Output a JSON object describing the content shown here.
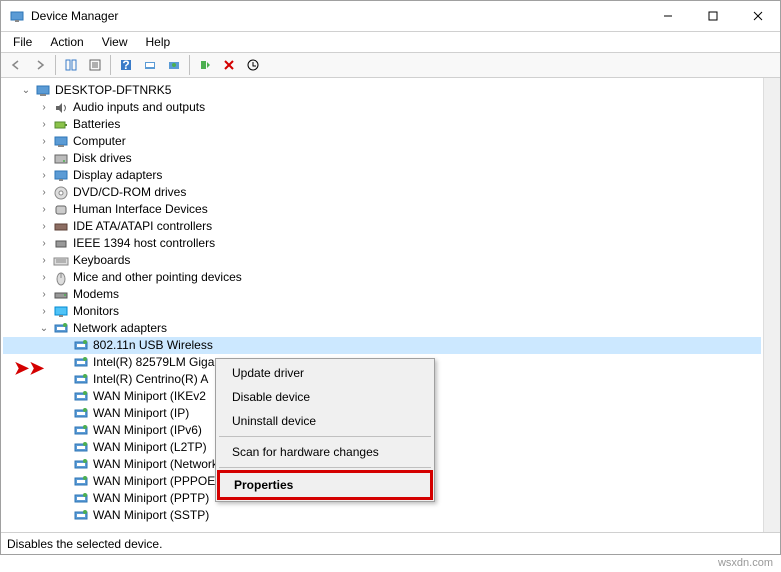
{
  "window": {
    "title": "Device Manager"
  },
  "menu": {
    "file": "File",
    "action": "Action",
    "view": "View",
    "help": "Help"
  },
  "root": "DESKTOP-DFTNRK5",
  "cats": [
    "Audio inputs and outputs",
    "Batteries",
    "Computer",
    "Disk drives",
    "Display adapters",
    "DVD/CD-ROM drives",
    "Human Interface Devices",
    "IDE ATA/ATAPI controllers",
    "IEEE 1394 host controllers",
    "Keyboards",
    "Mice and other pointing devices",
    "Modems",
    "Monitors"
  ],
  "netcat": "Network adapters",
  "net": [
    "802.11n USB Wireless",
    "Intel(R) 82579LM Giga",
    "Intel(R) Centrino(R) A",
    "WAN Miniport (IKEv2",
    "WAN Miniport (IP)",
    "WAN Miniport (IPv6)",
    "WAN Miniport (L2TP)",
    "WAN Miniport (Network Monitor)",
    "WAN Miniport (PPPOE)",
    "WAN Miniport (PPTP)",
    "WAN Miniport (SSTP)"
  ],
  "ctx": {
    "update": "Update driver",
    "disable": "Disable device",
    "uninstall": "Uninstall device",
    "scan": "Scan for hardware changes",
    "props": "Properties"
  },
  "status": "Disables the selected device.",
  "watermark": "wsxdn.com"
}
